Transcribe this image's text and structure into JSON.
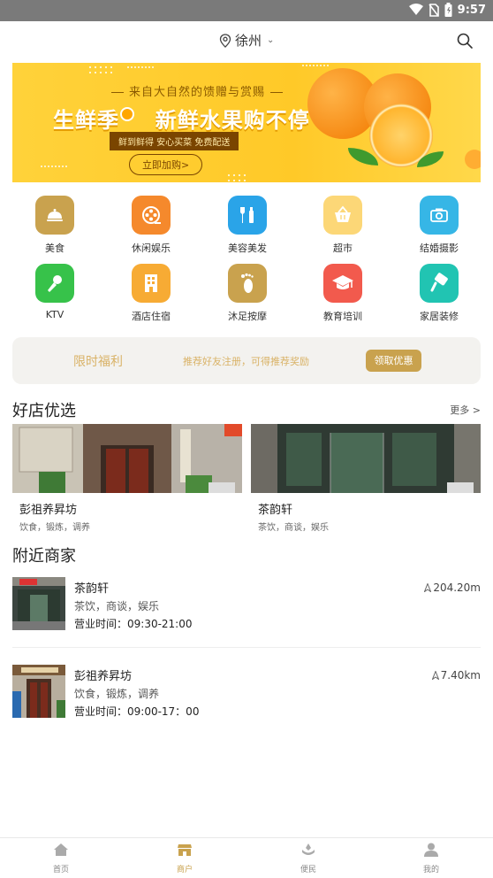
{
  "status_bar": {
    "time": "9:57"
  },
  "header": {
    "city": "徐州"
  },
  "banner": {
    "subtitle": "来自大自然的馈赠与赏赐",
    "headline_left": "生鲜季",
    "headline_right": "新鲜水果购不停",
    "tagline": "鲜到鲜得 安心买菜 免费配送",
    "cta": "立即加购>"
  },
  "categories": [
    {
      "label": "美食",
      "icon": "food-cloche-icon",
      "color": "#c9a24e"
    },
    {
      "label": "休闲娱乐",
      "icon": "film-reel-icon",
      "color": "#f5892c"
    },
    {
      "label": "美容美发",
      "icon": "beauty-icon",
      "color": "#2aa4e8"
    },
    {
      "label": "超市",
      "icon": "basket-icon",
      "color": "#fcd777"
    },
    {
      "label": "结婚摄影",
      "icon": "camera-icon",
      "color": "#36b6e6"
    },
    {
      "label": "KTV",
      "icon": "microphone-icon",
      "color": "#37c24a"
    },
    {
      "label": "酒店住宿",
      "icon": "hotel-icon",
      "color": "#f7ab34"
    },
    {
      "label": "沐足按摩",
      "icon": "footprint-icon",
      "color": "#c9a24e"
    },
    {
      "label": "教育培训",
      "icon": "graduation-cap-icon",
      "color": "#f25a4d"
    },
    {
      "label": "家居装修",
      "icon": "paint-roller-icon",
      "color": "#21c4b2"
    }
  ],
  "promo": {
    "title": "限时福利",
    "desc": "推荐好友注册，可得推荐奖励",
    "button": "领取优惠"
  },
  "featured": {
    "title": "好店优选",
    "more": "更多 >",
    "shops": [
      {
        "name": "彭祖养昇坊",
        "tags": "饮食，锻炼，调养"
      },
      {
        "name": "茶韵轩",
        "tags": "茶饮，商谈，娱乐"
      }
    ]
  },
  "nearby": {
    "title": "附近商家",
    "shops": [
      {
        "name": "茶韵轩",
        "tags": "茶饮，商谈，娱乐",
        "hours": "营业时间：09:30-21:00",
        "distance": "204.20m"
      },
      {
        "name": "彭祖养昇坊",
        "tags": "饮食，锻炼，调养",
        "hours": "营业时间：09:00-17：00",
        "distance": "7.40km"
      }
    ]
  },
  "tabbar": {
    "accent": "#c9a24e",
    "tabs": [
      {
        "label": "首页",
        "icon": "home-icon"
      },
      {
        "label": "商户",
        "icon": "store-icon"
      },
      {
        "label": "便民",
        "icon": "convenience-icon"
      },
      {
        "label": "我的",
        "icon": "user-icon"
      }
    ]
  }
}
